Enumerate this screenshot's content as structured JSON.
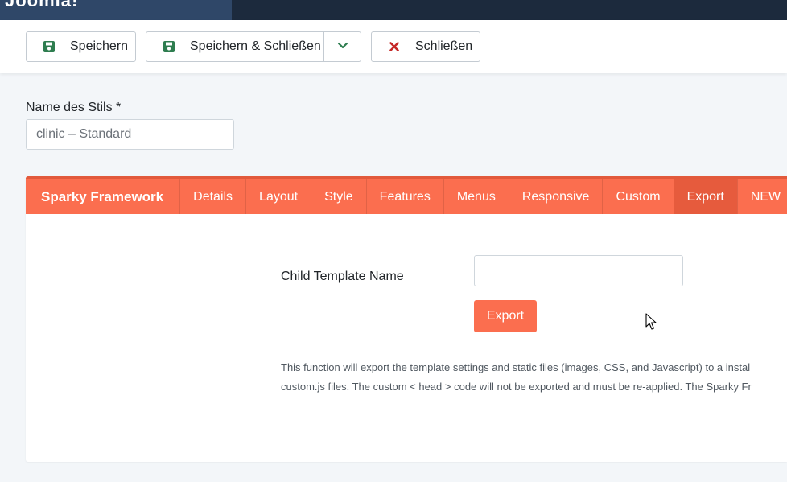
{
  "topbar": {
    "logo_text": "Joomla!"
  },
  "toolbar": {
    "save_label": "Speichern",
    "save_close_label": "Speichern & Schließen",
    "close_label": "Schließen"
  },
  "form": {
    "style_name_label": "Name des Stils *",
    "style_name_value": "clinic – Standard"
  },
  "tabs": {
    "brand": "Sparky Framework",
    "items": [
      "Details",
      "Layout",
      "Style",
      "Features",
      "Menus",
      "Responsive",
      "Custom",
      "Export",
      "NEW"
    ],
    "active": "Export"
  },
  "export": {
    "child_template_label": "Child Template Name",
    "export_button": "Export",
    "description_line1": "This function will export the template settings and static files (images, CSS, and Javascript) to a instal",
    "description_line2": "custom.js files. The custom < head > code will not be exported and must be re-applied. The Sparky Fr"
  },
  "colors": {
    "accent": "#fb6e4f",
    "accent_active": "#e65b3d",
    "topbar": "#1c2a3d",
    "save_icon": "#2e7d4f",
    "close_icon": "#c52827"
  }
}
